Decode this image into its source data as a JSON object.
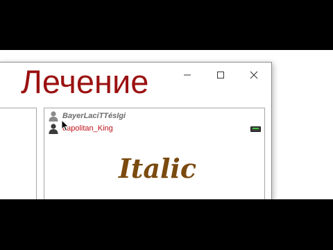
{
  "window": {
    "title": "Лечение",
    "controls": {
      "minimize": "minimize-icon",
      "maximize": "maximize-icon",
      "close": "close-icon"
    }
  },
  "user_list": {
    "users": [
      {
        "name": "BayerLaciTTésIgi",
        "icon": "user-icon",
        "status": ""
      },
      {
        "name": "eapolitan_King",
        "icon": "user-icon",
        "status": "connection-badge"
      }
    ],
    "style_preview": "Italic"
  },
  "colors": {
    "title": "#9b1111",
    "user_primary": "#6b6b6b",
    "user_secondary": "#c0111a",
    "preview_text": "#7a4a0f",
    "status_green": "#43c443"
  }
}
